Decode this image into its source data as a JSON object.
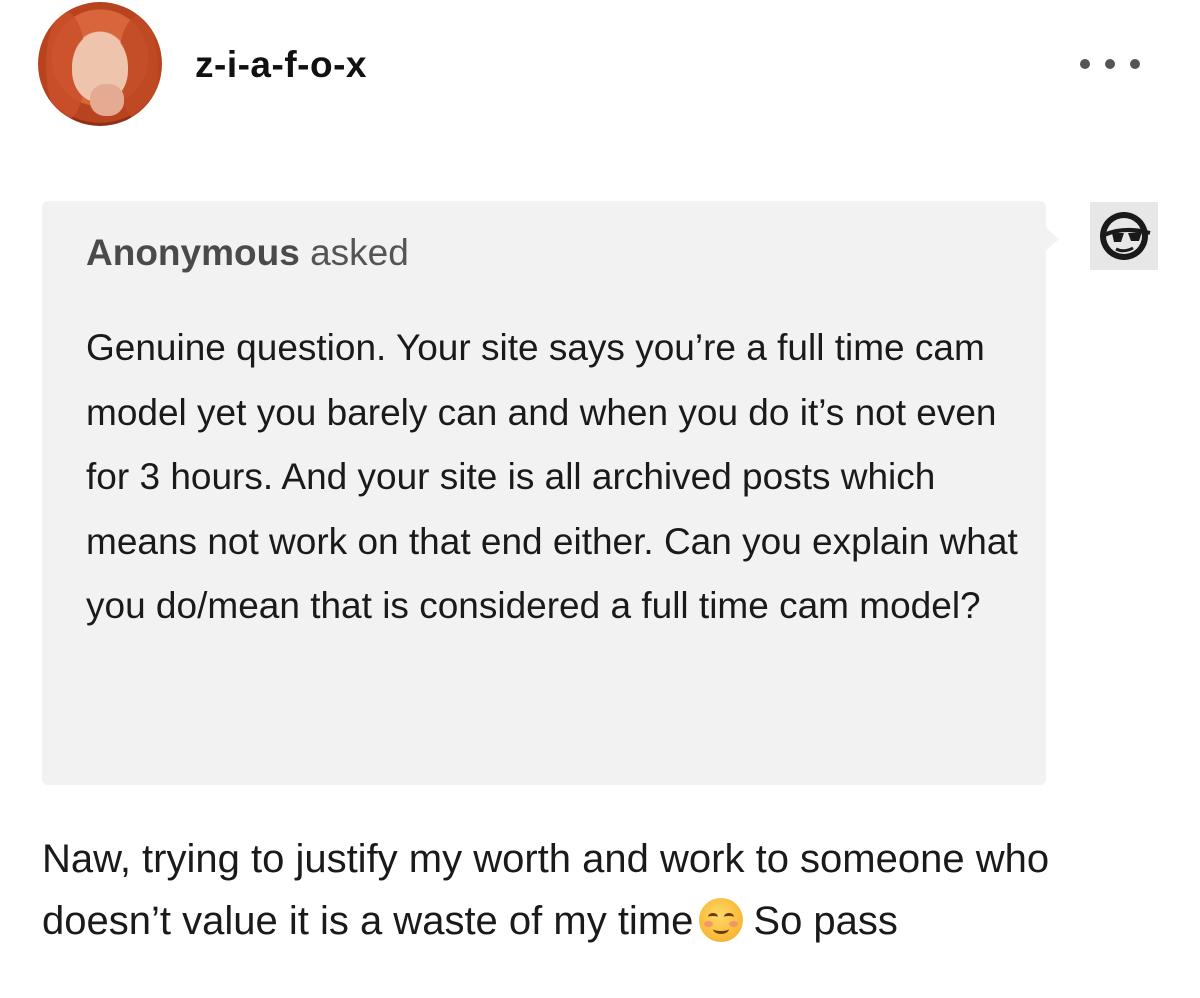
{
  "post": {
    "username": "z-i-a-f-o-x",
    "more_icon": "ellipsis-icon"
  },
  "ask": {
    "asker_name": "Anonymous",
    "asker_verb": "asked",
    "question": "Genuine question. Your site says you’re a full time cam model yet you barely can and when you do it’s not even for 3 hours. And your site is all archived posts which means not work on that end either. Can you explain what you do/mean that is considered a full time cam model?",
    "anon_avatar_icon": "sunglasses-face-icon"
  },
  "answer": {
    "text_before_emoji": "Naw, trying to justify my worth and work to someone who doesn’t value it is a waste of my time",
    "emoji": "smiling-face-icon",
    "text_after_emoji": "So pass"
  }
}
